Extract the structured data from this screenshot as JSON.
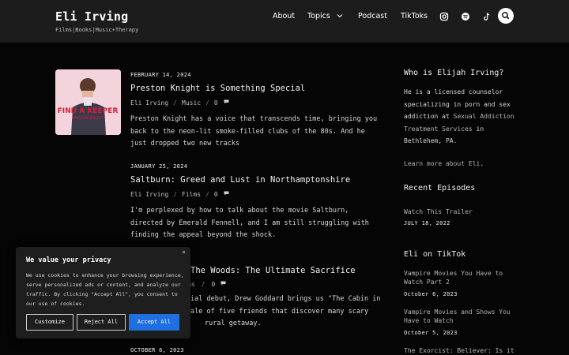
{
  "header": {
    "title": "Eli Irving",
    "tagline": "Films|Books|Music+Therapy",
    "nav": [
      "About",
      "Topics",
      "Podcast",
      "TikToks"
    ],
    "social_icons": [
      "instagram-icon",
      "spotify-icon",
      "tiktok-icon"
    ],
    "search_icon": "search-icon"
  },
  "posts": [
    {
      "date": "FEBRUARY 14, 2024",
      "title": "Preston Knight is Something Special",
      "author": "Eli Irving",
      "category": "Music",
      "comments": "0",
      "excerpt": "Preston Knight has a voice that transcends time, bringing you back to the neon-lit smoke-filled clubs of the 80s. And he just dropped two new tracks",
      "thumb_text_1": "FIND A KEEPER",
      "thumb_text_2": "PRESTON KNIGHT"
    },
    {
      "date": "JANUARY 25, 2024",
      "title": "Saltburn: Greed and Lust in Northamptonshire",
      "author": "Eli Irving",
      "category": "Films",
      "comments": "0",
      "excerpt": "I'm perplexed by how to talk about the movie Saltburn, directed by Emerald Fennell, and I am still struggling with finding the appeal beyond the shock."
    },
    {
      "title_visible": "The Woods: The Ultimate Sacrifice",
      "category_visible": "ms",
      "comments": "0",
      "excerpt_lines": [
        "ial debut, Drew Goddard brings us \"The Cabin in",
        "ale of five friends that discover many scary",
        "rural getaway."
      ]
    },
    {
      "date": "OCTOBER 6, 2023"
    }
  ],
  "sidebar": {
    "about_heading": "Who is Elijah Irving?",
    "about_text_pre": "He is a licensed counselor specializing in porn and sex addiction at",
    "about_link": "Sexual Addiction Treatment Services",
    "about_text_post": "in Bethlehem, PA.",
    "learn_more_link": "Learn more about Eli",
    "learn_more_period": ".",
    "episodes_heading": "Recent Episodes",
    "episodes": [
      {
        "title": "Watch This Trailer",
        "date": "JULY 18, 2022"
      }
    ],
    "tiktok_heading": "Eli on TikTok",
    "tiktoks": [
      {
        "title": "Vampire Movies You Have to Watch Part 2",
        "date": "October 6, 2023"
      },
      {
        "title": "Vampire Movies and Shows You Have to Watch",
        "date": "October 5, 2023"
      },
      {
        "title": "The Exorcist: Believer: Is it"
      }
    ]
  },
  "cookie": {
    "title": "We value your privacy",
    "close": "×",
    "text": "We use cookies to enhance your browsing experience, serve personalized ads or content, and analyze our traffic. By clicking \"Accept All\", you consent to our use of cookies.",
    "customize": "Customize",
    "reject": "Reject All",
    "accept": "Accept All",
    "accent_color": "#1f6fe0"
  }
}
